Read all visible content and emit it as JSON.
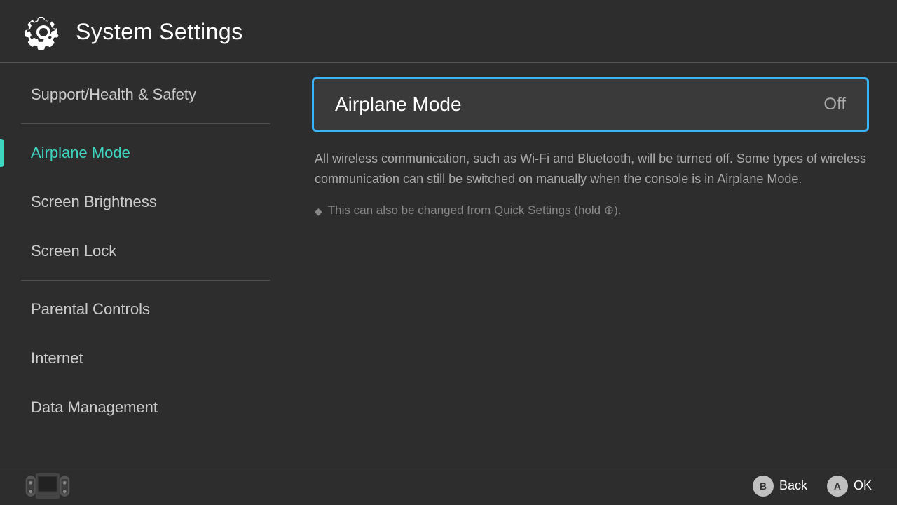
{
  "header": {
    "title": "System Settings",
    "gear_icon": "gear-icon"
  },
  "sidebar": {
    "items": [
      {
        "id": "support-health-safety",
        "label": "Support/Health & Safety",
        "active": false,
        "divider_before": false,
        "divider_after": true
      },
      {
        "id": "airplane-mode",
        "label": "Airplane Mode",
        "active": true,
        "divider_before": false,
        "divider_after": false
      },
      {
        "id": "screen-brightness",
        "label": "Screen Brightness",
        "active": false,
        "divider_before": false,
        "divider_after": false
      },
      {
        "id": "screen-lock",
        "label": "Screen Lock",
        "active": false,
        "divider_before": false,
        "divider_after": true
      },
      {
        "id": "parental-controls",
        "label": "Parental Controls",
        "active": false,
        "divider_before": false,
        "divider_after": false
      },
      {
        "id": "internet",
        "label": "Internet",
        "active": false,
        "divider_before": false,
        "divider_after": false
      },
      {
        "id": "data-management",
        "label": "Data Management",
        "active": false,
        "divider_before": false,
        "divider_after": false
      }
    ]
  },
  "content": {
    "selected_label": "Airplane Mode",
    "selected_value": "Off",
    "description": "All wireless communication, such as Wi-Fi and Bluetooth, will be turned off. Some types of wireless communication can still be switched on manually when the console is in Airplane Mode.",
    "hint": "This can also be changed from Quick Settings (hold ⊕)."
  },
  "footer": {
    "back_label": "Back",
    "ok_label": "OK",
    "btn_b": "B",
    "btn_a": "A"
  }
}
